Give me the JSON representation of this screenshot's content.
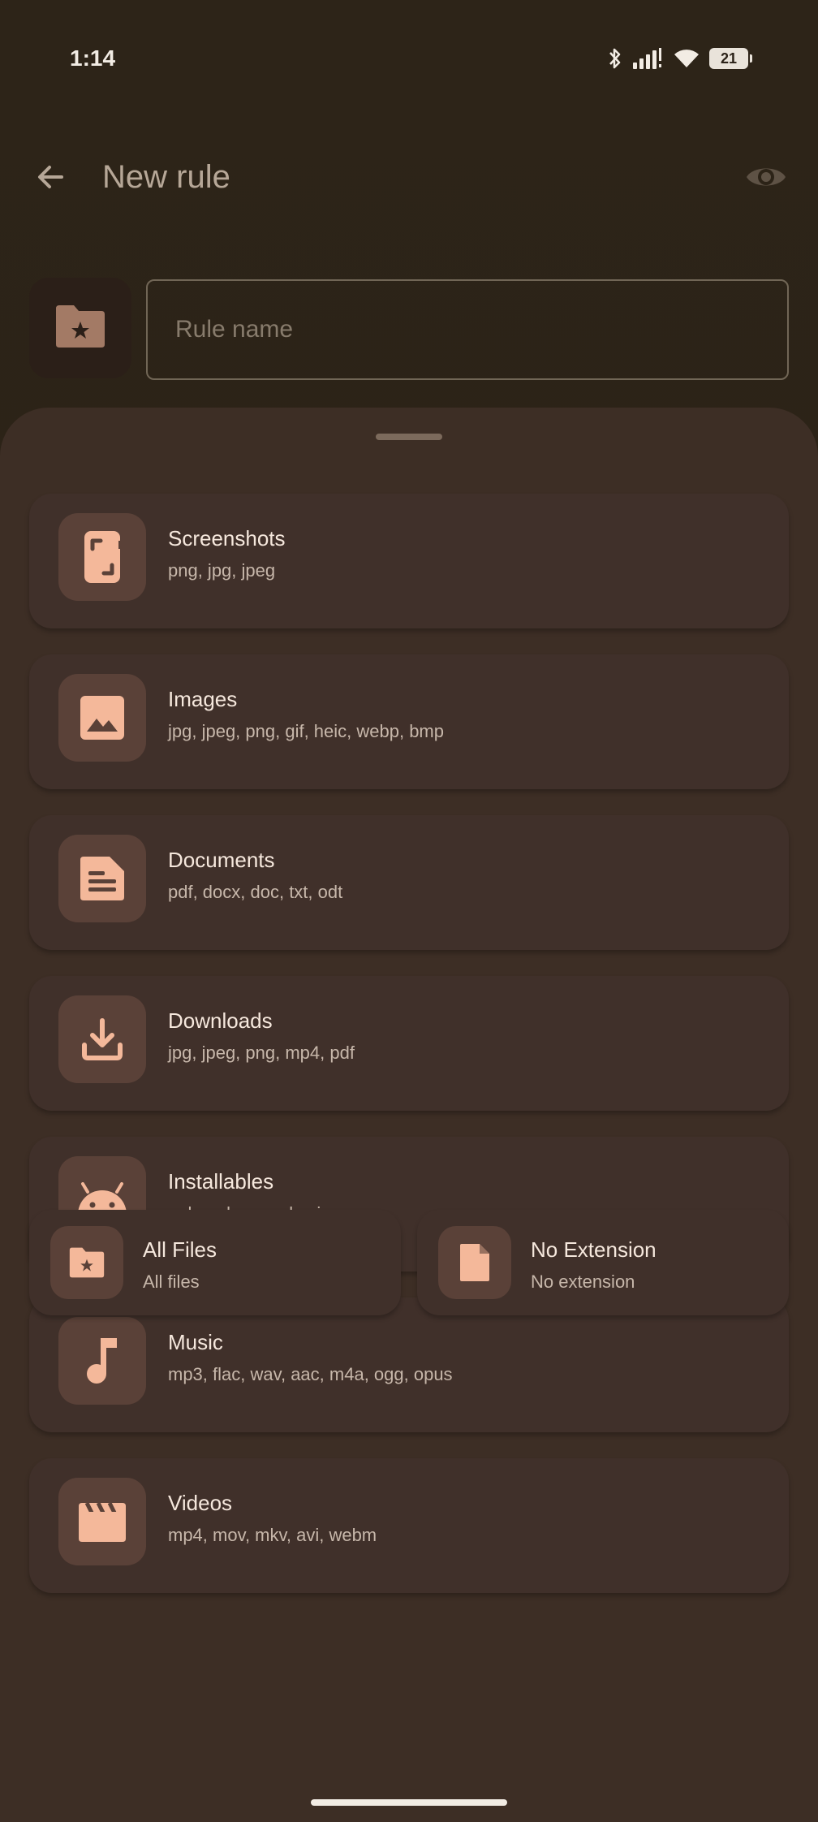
{
  "status": {
    "time": "1:14",
    "battery": "21"
  },
  "header": {
    "title": "New rule"
  },
  "rule_name": {
    "placeholder": "Rule name",
    "value": ""
  },
  "categories": [
    {
      "title": "Screenshots",
      "extensions": "png, jpg, jpeg",
      "icon": "screenshot-icon"
    },
    {
      "title": "Images",
      "extensions": "jpg, jpeg, png, gif, heic, webp, bmp",
      "icon": "image-icon"
    },
    {
      "title": "Documents",
      "extensions": "pdf, docx, doc, txt, odt",
      "icon": "document-icon"
    },
    {
      "title": "Downloads",
      "extensions": "jpg, jpeg, png, mp4, pdf",
      "icon": "download-icon"
    },
    {
      "title": "Installables",
      "extensions": "apk, apkm, xapk, zip",
      "icon": "android-icon"
    },
    {
      "title": "Music",
      "extensions": "mp3, flac, wav, aac, m4a, ogg, opus",
      "icon": "music-note-icon"
    },
    {
      "title": "Videos",
      "extensions": "mp4, mov, mkv, avi, webm",
      "icon": "clapperboard-icon"
    }
  ],
  "bottom_options": [
    {
      "title": "All Files",
      "subtitle": "All files",
      "icon": "folder-star-icon"
    },
    {
      "title": "No Extension",
      "subtitle": "No extension",
      "icon": "file-icon"
    }
  ],
  "colors": {
    "accent": "#f4b89a",
    "sheet": "#3d2e25",
    "card": "#40302a"
  }
}
